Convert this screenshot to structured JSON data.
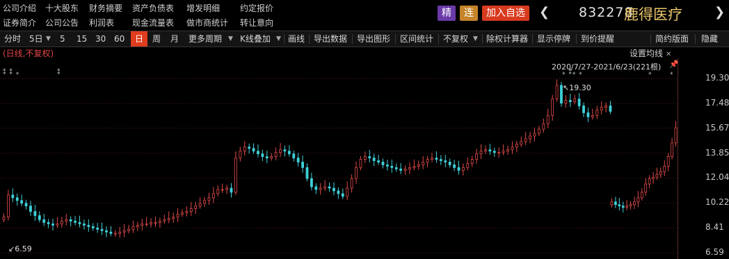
{
  "info_links_row1": [
    "公司介绍",
    "十大股东",
    "财务摘要",
    "资产负债表",
    "增发明细",
    "约定报价"
  ],
  "info_links_row2": [
    "证券简介",
    "公司公告",
    "利润表",
    "现金流量表",
    "做市商统计",
    "转让意向"
  ],
  "badges": {
    "jing": "精",
    "lian": "连",
    "add": "加入自选"
  },
  "stock": {
    "code": "832278",
    "name": "鹿得医疗",
    "prev": "❮",
    "next": "❯"
  },
  "toolbar": {
    "items": [
      "分时",
      "5日",
      "5",
      "15",
      "30",
      "60",
      "日",
      "周",
      "月",
      "更多周期",
      "K线叠加",
      "画线",
      "导出数据",
      "导出图形",
      "区间统计",
      "不复权",
      "除权计算器",
      "显示停牌",
      "到价提醒",
      "简约版面",
      "隐藏"
    ],
    "selected": "日"
  },
  "subinfo": "(日线,不复权)",
  "set_avg": "设置均线",
  "range_label": "2020/7/27-2021/6/23(221根)",
  "annotations": {
    "high": "19.30",
    "low": "6.59"
  },
  "markers_left": "⁑ ⁑ ⁎",
  "colors": {
    "up": "#e24a4a",
    "down": "#3fd0d8",
    "accent": "#e03c1e",
    "badge_jing": "#6a3aa8",
    "badge_lian": "#c6842a",
    "badge_add": "#d83a1e"
  },
  "chart_data": {
    "type": "candlestick",
    "y_ticks": [
      "19.30",
      "17.48",
      "15.67",
      "13.85",
      "12.04",
      "10.22",
      "8.41",
      "6.59"
    ],
    "ylim": [
      6.59,
      19.3
    ],
    "high": 19.3,
    "low": 6.59,
    "approx_close_path": [
      9.2,
      10.8,
      10.6,
      10.4,
      10.2,
      10.0,
      9.6,
      9.3,
      9.0,
      8.8,
      8.7,
      8.6,
      8.7,
      8.9,
      9.0,
      8.9,
      8.8,
      8.7,
      8.6,
      8.5,
      8.4,
      8.3,
      8.2,
      8.1,
      8.0,
      8.0,
      8.1,
      8.2,
      8.3,
      8.5,
      8.6,
      8.7,
      8.7,
      8.8,
      8.8,
      8.9,
      9.0,
      9.1,
      9.2,
      9.4,
      9.5,
      9.6,
      9.8,
      10.0,
      10.2,
      10.4,
      10.6,
      10.9,
      11.2,
      11.2,
      11.3,
      11.0,
      13.5,
      14.0,
      14.3,
      14.2,
      14.0,
      13.8,
      13.6,
      13.5,
      13.6,
      13.9,
      14.1,
      14.0,
      13.8,
      13.5,
      13.2,
      12.8,
      12.0,
      11.4,
      11.2,
      11.3,
      11.4,
      11.3,
      11.1,
      10.9,
      10.7,
      11.3,
      12.0,
      12.8,
      13.4,
      13.6,
      13.5,
      13.3,
      13.2,
      13.0,
      12.9,
      12.8,
      12.7,
      12.6,
      12.7,
      12.8,
      12.9,
      13.0,
      13.2,
      13.4,
      13.5,
      13.4,
      13.3,
      13.2,
      13.0,
      12.8,
      12.6,
      12.8,
      13.1,
      13.4,
      13.8,
      14.0,
      14.1,
      14.0,
      13.9,
      13.9,
      14.0,
      14.1,
      14.3,
      14.5,
      14.7,
      14.9,
      15.1,
      15.3,
      15.6,
      16.0,
      16.6,
      17.8,
      18.8,
      17.5,
      17.7,
      17.6,
      17.8,
      17.3,
      16.8,
      16.5,
      16.6,
      17.0,
      17.2,
      17.3,
      16.9
    ],
    "approx_close_path_after_gap": [
      10.3,
      10.1,
      10.0,
      9.9,
      10.0,
      10.1,
      10.3,
      10.6,
      11.0,
      11.6,
      12.0,
      12.1,
      12.3,
      12.5,
      12.9,
      13.6,
      14.6,
      15.7
    ]
  }
}
